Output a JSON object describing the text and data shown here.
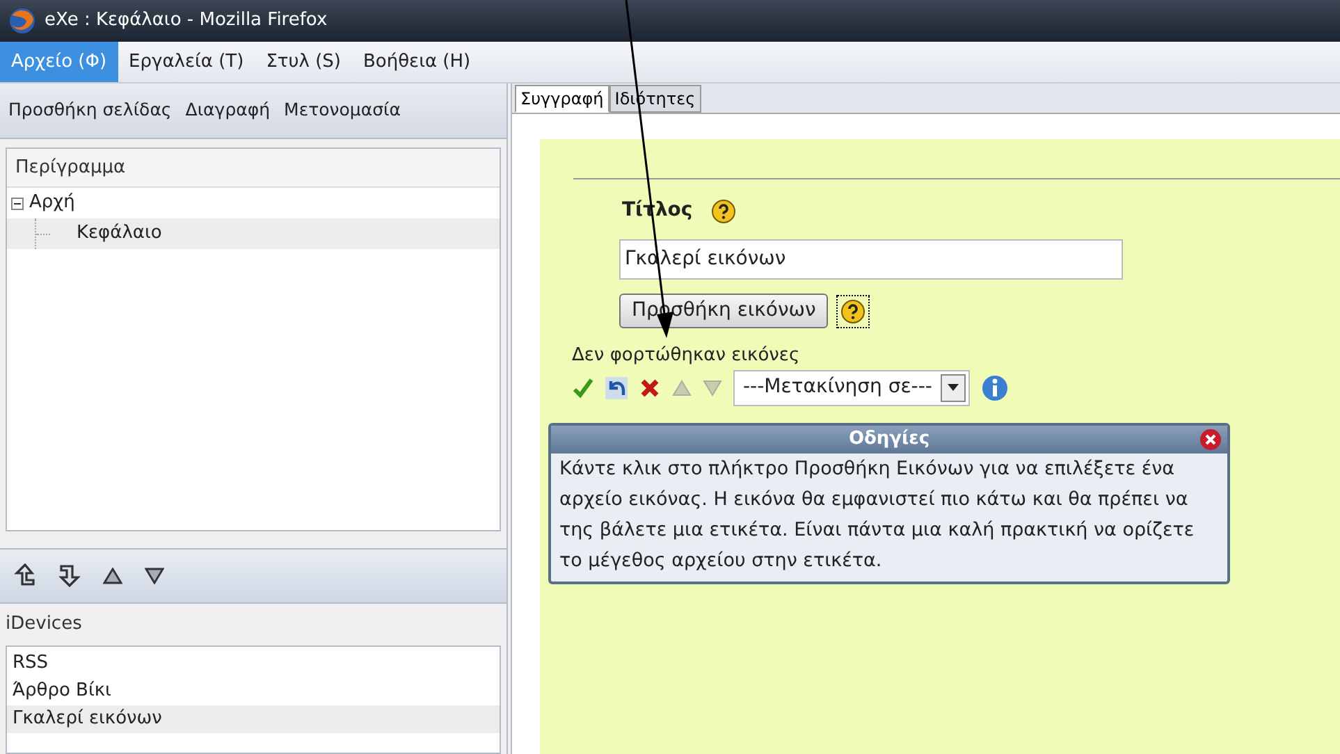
{
  "window": {
    "title": "eXe : Κεφάλαιο - Mozilla Firefox"
  },
  "menu": [
    {
      "label": "Αρχείο (Φ)",
      "selected": true
    },
    {
      "label": "Εργαλεία (Τ)",
      "selected": false
    },
    {
      "label": "Στυλ (S)",
      "selected": false
    },
    {
      "label": "Βοήθεια (H)",
      "selected": false
    }
  ],
  "outline_toolbar": [
    "Προσθήκη σελίδας",
    "Διαγραφή",
    "Μετονομασία"
  ],
  "outline": {
    "header": "Περίγραμμα",
    "tree": [
      {
        "label": "Αρχή",
        "expanded": true,
        "selected": false,
        "children": [
          {
            "label": "Κεφάλαιο",
            "selected": true
          }
        ]
      }
    ]
  },
  "idevices": {
    "header": "iDevices",
    "items": [
      {
        "label": "RSS",
        "selected": false
      },
      {
        "label": "Άρθρο Βίκι",
        "selected": false
      },
      {
        "label": "Γκαλερί εικόνων",
        "selected": true
      }
    ]
  },
  "tabs": [
    {
      "label": "Συγγραφή",
      "selected": true
    },
    {
      "label": "Ιδιότητες",
      "selected": false
    }
  ],
  "editor": {
    "title_label": "Τίτλος",
    "title_value": "Γκαλερί εικόνων",
    "add_button": "Προσθήκη εικόνων",
    "status": "Δεν φορτώθηκαν εικόνες",
    "move_select": "---Μετακίνηση σε---"
  },
  "instructions": {
    "title": "Οδηγίες",
    "text": "Κάντε κλικ στο πλήκτρο Προσθήκη Εικόνων για να επιλέξετε ένα αρχείο εικόνας. Η εικόνα θα εμφανιστεί πιο κάτω και θα πρέπει να της βάλετε μια ετικέτα. Είναι πάντα μια καλή πρακτική να ορίζετε το μέγεθος αρχείου στην ετικέτα."
  }
}
